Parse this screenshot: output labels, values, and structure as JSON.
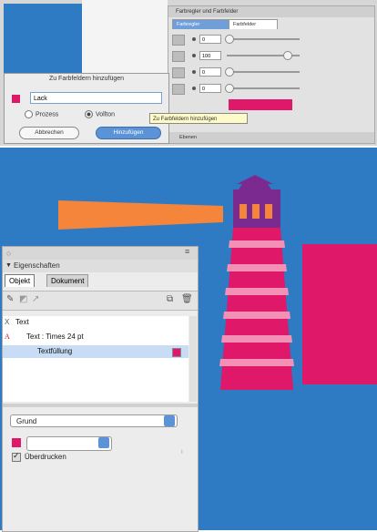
{
  "colors": {
    "canvas_blue": "#2e7bc4",
    "pink": "#e0186a",
    "light_pink": "#f490b6",
    "orange": "#f5853a",
    "purple": "#7b2b8f",
    "selection": "#c8ddf5"
  },
  "swatch_panel": {
    "title": "Farbregler und Farbfelder",
    "tabs": [
      "Farbregler",
      "Farbfelder"
    ],
    "fields": [
      "0",
      "100",
      "0",
      "0"
    ],
    "footer": "Ebenen"
  },
  "add_dialog": {
    "title": "Zu Farbfeldern hinzufügen",
    "name_value": "Lack",
    "radio_process": "Prozess",
    "radio_full": "Vollton",
    "cancel_label": "Abbrechen",
    "add_label": "Hinzufügen",
    "tooltip": "Zu Farbfeldern hinzufügen"
  },
  "properties": {
    "heading": "Eigenschaften",
    "tabs": {
      "object": "Objekt",
      "document": "Dokument"
    },
    "items": [
      {
        "icon": "X",
        "label": "Text"
      },
      {
        "icon": "A",
        "label": "Text : Times 24 pt"
      },
      {
        "icon": "",
        "label": "Textfüllung"
      }
    ],
    "type_select": "Grund",
    "overprint_label": "Überdrucken"
  }
}
